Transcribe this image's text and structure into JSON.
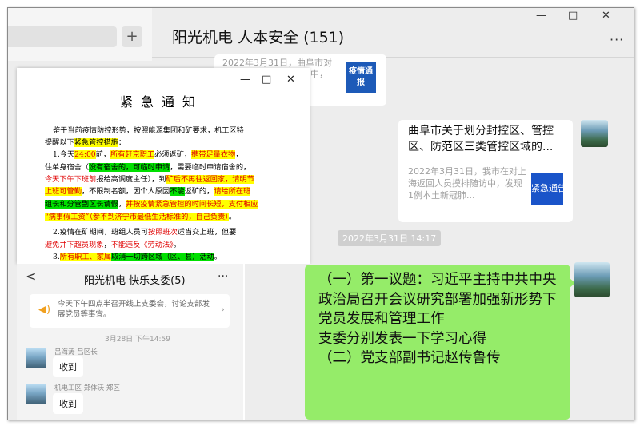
{
  "sidebar": {
    "plus_label": "+"
  },
  "chat": {
    "title": "阳光机电 人本安全 (151)",
    "more": "···",
    "window_controls": [
      "—",
      "□",
      "✕"
    ],
    "card_small": {
      "text": "2022年3月31日，曲阜市对上海返回人员摸排随访中，发现1例本土新冠...",
      "thumb": "疫情通报"
    },
    "card_big": {
      "title": "曲阜市关于划分封控区、管控区、防范区三类管控区域的...",
      "desc": "2022年3月31日，我市在对上海返回人员摸排随访中，发现1例本土新冠肺...",
      "thumb": "紧急通告"
    },
    "timestamp": "2022年3月31日 14:17"
  },
  "document": {
    "window_controls": [
      "—",
      "□",
      "✕"
    ],
    "title": "紧急通知",
    "lines": [
      [
        "鉴于当前疫情防控形势，按照能源集团和矿要求，机工区特"
      ],
      [
        "提醒以下",
        {
          "t": "紧急管控措施",
          "c": "hy"
        },
        "："
      ],
      [
        "1.今天",
        {
          "t": "24:00",
          "c": "hy rd"
        },
        "前，",
        {
          "t": "所有赶京职工",
          "c": "hy rd"
        },
        "必须返矿，",
        {
          "t": "携带足量衣物",
          "c": "hy rd"
        },
        "，"
      ],
      [
        "住单身宿舍（",
        {
          "t": "没有宿舍的，可临时申请",
          "c": "hg"
        },
        "，需要临时申请宿舍的，"
      ],
      [
        {
          "t": "今天下午下班前",
          "c": "rd"
        },
        "报给高调度主任），到",
        {
          "t": "矿后不再往返回家，请明节",
          "c": "hy rd"
        }
      ],
      [
        {
          "t": "上班可管勤",
          "c": "hy rd"
        },
        "，不限制名额，因个人原因",
        {
          "t": "不能",
          "c": "hg"
        },
        "返矿的，",
        {
          "t": "请给所在班",
          "c": "hy rd"
        }
      ],
      [
        {
          "t": "组长和分管副区长请假",
          "c": "hg"
        },
        "，",
        {
          "t": "并按疫情紧急管控的时间长短，支付相应",
          "c": "hy rd"
        }
      ],
      [
        {
          "t": "“病事假工资”（参不到济宁市最低生活标准的，自己负责）",
          "c": "hy rd"
        },
        "。"
      ],
      [
        "2.疫情在矿",
        {
          "t": "期间",
          "c": ""
        },
        "，班组人员可",
        {
          "t": "按照班次",
          "c": "rd"
        },
        "适当",
        {
          "t": "交",
          "c": ""
        },
        "上班，但要"
      ],
      [
        {
          "t": "避免井下超员现象",
          "c": "rd"
        },
        "，",
        {
          "t": "不能违反《劳动法》",
          "c": "rd"
        },
        "。"
      ],
      [
        "3.",
        {
          "t": "所有职工、家属",
          "c": "hy rd"
        },
        {
          "t": "取消一切跨区域（区、县）活动",
          "c": "hg"
        },
        "。"
      ]
    ]
  },
  "mobile": {
    "back": "<",
    "title": "阳光机电 快乐支委(5)",
    "more": "···",
    "notice_icon": "speaker-icon",
    "notice": "今天下午四点半召开线上支委会，讨论支部发展党员等事宜。",
    "notice_arrow": "›",
    "time": "3月28日 下午14:59",
    "messages": [
      {
        "name": "吕海涛 吕区长",
        "text": "收到"
      },
      {
        "name": "机电工区 郑体沃 郑区",
        "text": "收到"
      }
    ]
  },
  "message": {
    "text": "（一）第一议题：习近平主持中共中央政治局召开会议研究部署加强新形势下党员发展和管理工作\n支委分别发表一下学习心得\n（二）党支部副书记赵传鲁传"
  }
}
